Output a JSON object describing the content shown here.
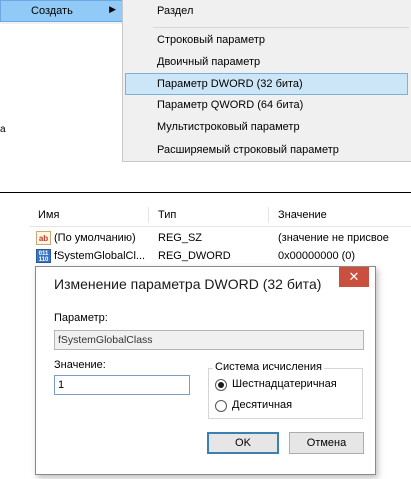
{
  "context_menu": {
    "create_label": "Создать",
    "side_letter": "а",
    "submenu_items": [
      "Раздел",
      "Строковый параметр",
      "Двоичный параметр",
      "Параметр DWORD (32 бита)",
      "Параметр QWORD (64 бита)",
      "Мультистроковый параметр",
      "Расширяемый строковый параметр"
    ]
  },
  "list": {
    "headers": [
      "Имя",
      "Тип",
      "Значение"
    ],
    "rows": [
      {
        "icon": "ab",
        "name": "(По умолчанию)",
        "type": "REG_SZ",
        "value": "(значение не присвое"
      },
      {
        "icon": "binary",
        "name": "fSystemGlobalCl...",
        "type": "REG_DWORD",
        "value": "0x00000000 (0)"
      }
    ]
  },
  "dialog": {
    "title": "Изменение параметра DWORD (32 бита)",
    "close_glyph": "✕",
    "param_label": "Параметр:",
    "param_value": "fSystemGlobalClass",
    "value_label": "Значение:",
    "value_value": "1",
    "base_legend": "Система исчисления",
    "base_hex": "Шестнадцатеричная",
    "base_dec": "Десятичная",
    "base_selected": "hex",
    "ok_label": "OK",
    "cancel_label": "Отмена"
  },
  "colors": {
    "menu_highlight": "#91c9f7",
    "submenu_highlight": "#cde6f7",
    "close_button": "#c94f3f",
    "ok_border": "#3c7fb1"
  }
}
